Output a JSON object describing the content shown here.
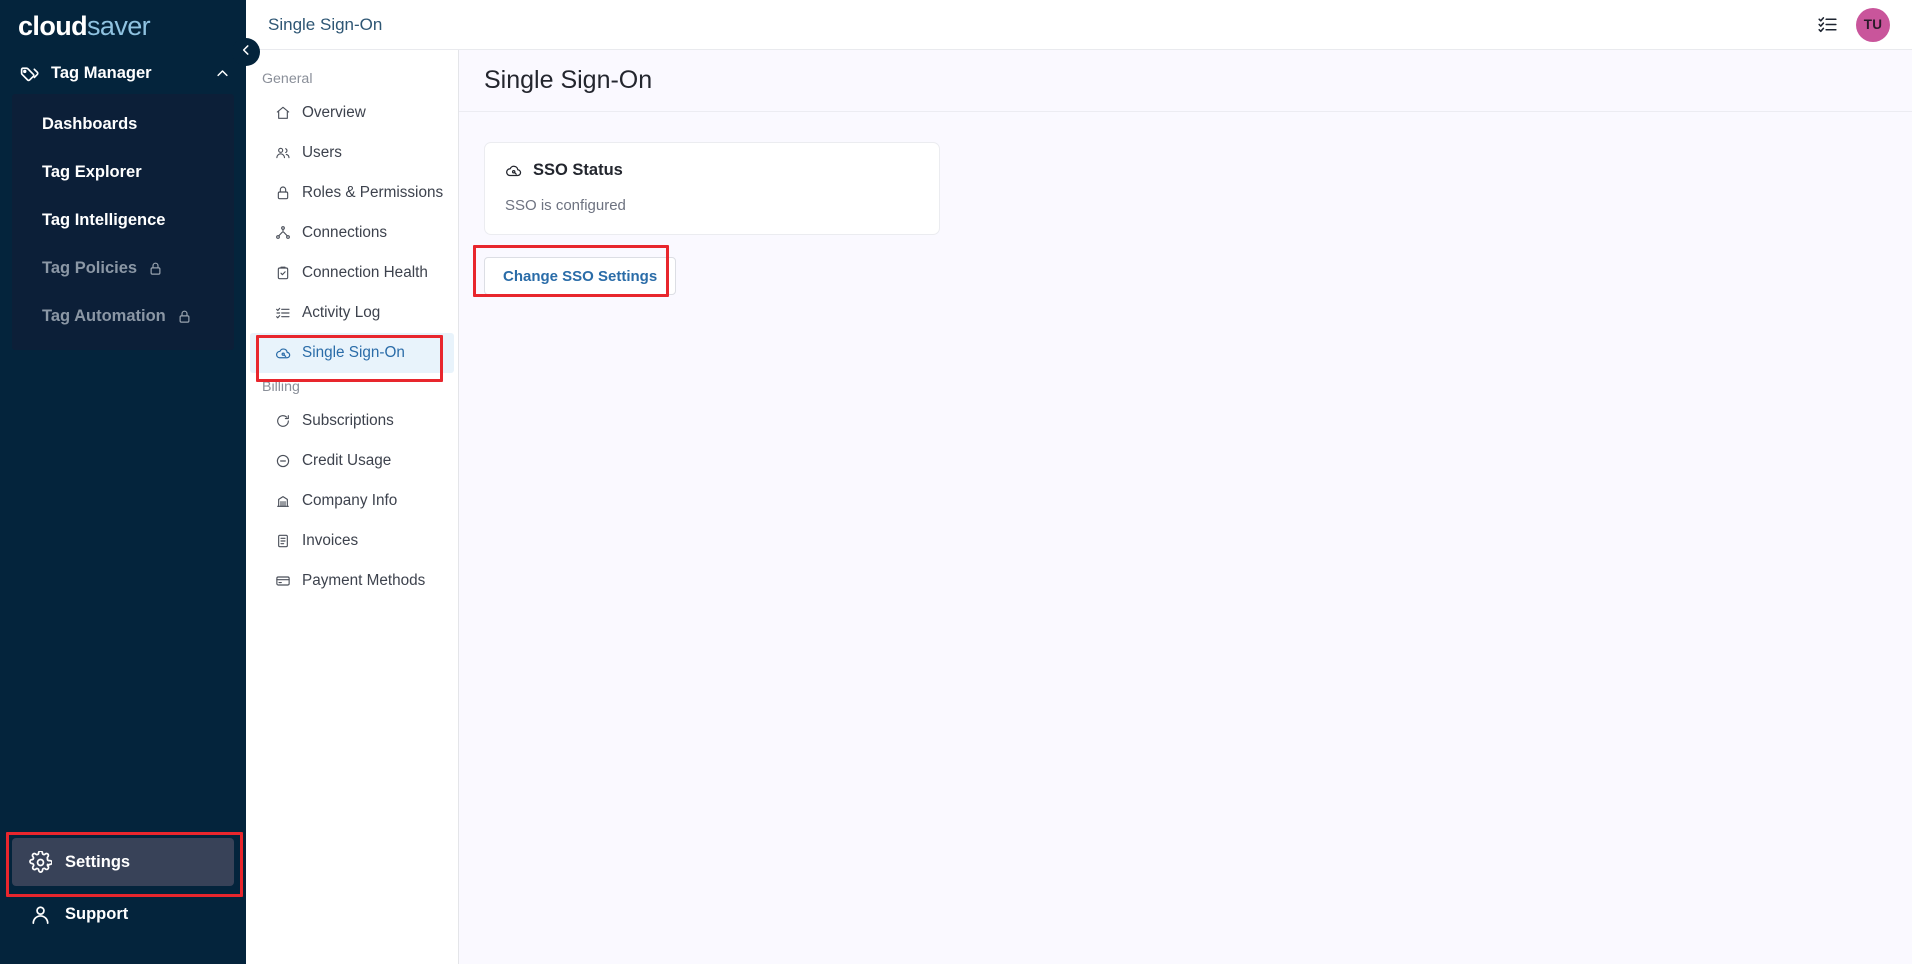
{
  "brand": {
    "logo_primary": "cloud",
    "logo_secondary": "saver",
    "accent_blue": "#2a6ca8",
    "sidebar_bg": "#04243c",
    "annotation_red": "#e8262d",
    "avatar_bg": "#c9559b",
    "main_bg": "#faf9ff"
  },
  "sidebar": {
    "section": {
      "label": "Tag Manager",
      "icon": "tags-icon",
      "chevron": "chevron-up-icon",
      "expanded": true
    },
    "items": [
      {
        "label": "Dashboards",
        "locked": false
      },
      {
        "label": "Tag Explorer",
        "locked": false
      },
      {
        "label": "Tag Intelligence",
        "locked": false
      },
      {
        "label": "Tag Policies",
        "locked": true
      },
      {
        "label": "Tag Automation",
        "locked": true
      }
    ],
    "bottom": [
      {
        "label": "Settings",
        "icon": "gear-icon",
        "active": true
      },
      {
        "label": "Support",
        "icon": "lifebuoy-icon",
        "active": false
      }
    ],
    "collapse_icon": "chevron-left-icon"
  },
  "topbar": {
    "breadcrumb": "Single Sign-On",
    "tasks_icon": "checklist-icon",
    "avatar_initials": "TU"
  },
  "subnav": {
    "groups": [
      {
        "label": "General",
        "items": [
          {
            "label": "Overview",
            "icon": "home-icon",
            "active": false
          },
          {
            "label": "Users",
            "icon": "users-icon",
            "active": false
          },
          {
            "label": "Roles & Permissions",
            "icon": "lock-icon",
            "active": false
          },
          {
            "label": "Connections",
            "icon": "network-icon",
            "active": false
          },
          {
            "label": "Connection Health",
            "icon": "clipboard-check-icon",
            "active": false
          },
          {
            "label": "Activity Log",
            "icon": "list-checks-icon",
            "active": false
          },
          {
            "label": "Single Sign-On",
            "icon": "cloud-key-icon",
            "active": true
          }
        ]
      },
      {
        "label": "Billing",
        "items": [
          {
            "label": "Subscriptions",
            "icon": "refresh-circle-icon",
            "active": false
          },
          {
            "label": "Credit Usage",
            "icon": "minus-circle-icon",
            "active": false
          },
          {
            "label": "Company Info",
            "icon": "bank-icon",
            "active": false
          },
          {
            "label": "Invoices",
            "icon": "document-icon",
            "active": false
          },
          {
            "label": "Payment Methods",
            "icon": "credit-card-icon",
            "active": false
          }
        ]
      }
    ]
  },
  "main": {
    "page_title": "Single Sign-On",
    "card": {
      "icon": "cloud-key-icon",
      "title": "SSO Status",
      "status": "SSO is configured"
    },
    "change_button": "Change SSO Settings"
  }
}
